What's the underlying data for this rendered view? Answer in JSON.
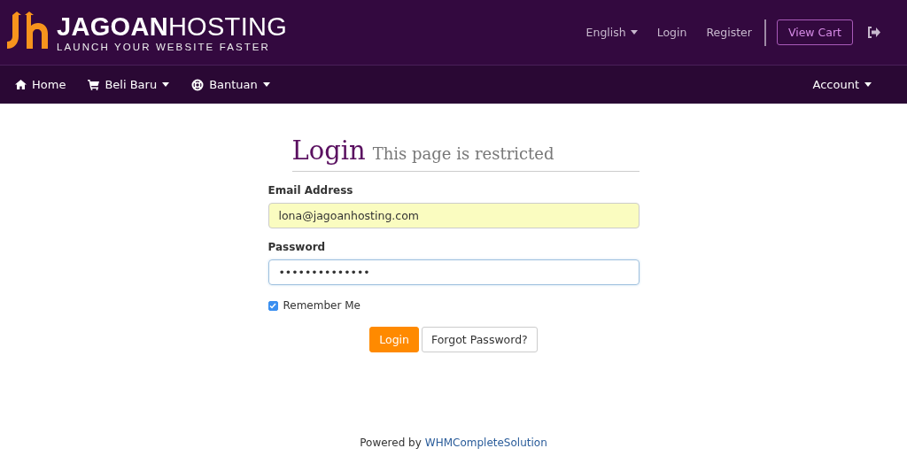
{
  "brand": {
    "name": "**JAGOAN**HOSTING",
    "tagline": "LAUNCH YOUR WEBSITE FASTER"
  },
  "top_links": [
    {
      "label": "English",
      "dropdown": true
    },
    {
      "label": "Login",
      "dropdown": false
    },
    {
      "label": "Register",
      "dropdown": false
    }
  ],
  "cart_button": "View Cart",
  "nav": [
    {
      "label": "Home",
      "dropdown": false
    },
    {
      "label": "Beli Baru",
      "dropdown": true
    },
    {
      "label": "Bantuan",
      "dropdown": true
    }
  ],
  "nav_right": {
    "label": "Account",
    "dropdown": true
  },
  "heading": {
    "title": "Login",
    "subtitle": "This page is restricted"
  },
  "fields": [
    {
      "label": "Email Address",
      "value": "lona@jagoanhosting.com",
      "autofilled": true
    },
    {
      "label": "Password",
      "value": "••••••••••••••",
      "autofilled": false
    }
  ],
  "remember": {
    "label": "Remember Me",
    "checked": true
  },
  "buttons": [
    {
      "label": "Login",
      "kind": "primary"
    },
    {
      "label": "Forgot Password?",
      "kind": "default"
    }
  ],
  "footer": {
    "text": "Powered by",
    "link": "WHMCompleteSolution"
  }
}
